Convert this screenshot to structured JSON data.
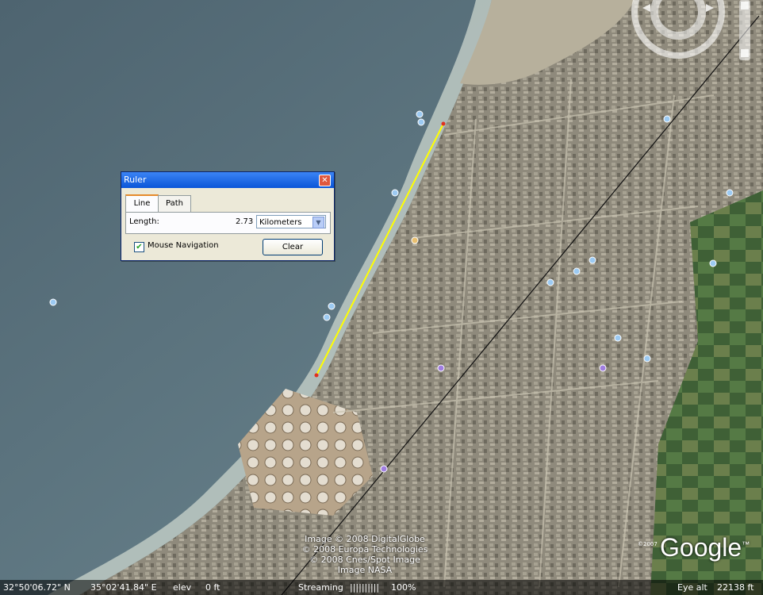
{
  "ruler": {
    "title": "Ruler",
    "close_glyph": "✕",
    "tabs": [
      "Line",
      "Path"
    ],
    "length_label": "Length:",
    "length_value": "2.73",
    "unit": "Kilometers",
    "checkbox_checked": true,
    "mouse_nav_label": "Mouse Navigation",
    "clear_label": "Clear"
  },
  "credits": [
    "Image © 2008 DigitalGlobe",
    "© 2008 Europa Technologies",
    "© 2008 Cnes/Spot Image",
    "Image NASA"
  ],
  "logo": {
    "text": "Google",
    "tm": "™",
    "year": "©2007"
  },
  "status": {
    "lat": "32°50'06.72\" N",
    "lon": "35°02'41.84\" E",
    "elev_label": "elev",
    "elev_value": "0 ft",
    "streaming_label": "Streaming",
    "streaming_bar": "||||||||||",
    "streaming_pct": "100%",
    "eye_alt_label": "Eye alt",
    "eye_alt_value": "22138 ft"
  },
  "colors": {
    "sea": "#5f7885",
    "land": "#8a8575",
    "measure_line": "#ffff00",
    "titlebar": "#0a55d8"
  },
  "icons": [
    "compass-icon",
    "zoom-slider-icon",
    "placemark-icon",
    "close-icon",
    "chevron-down-icon",
    "checkmark-icon"
  ]
}
